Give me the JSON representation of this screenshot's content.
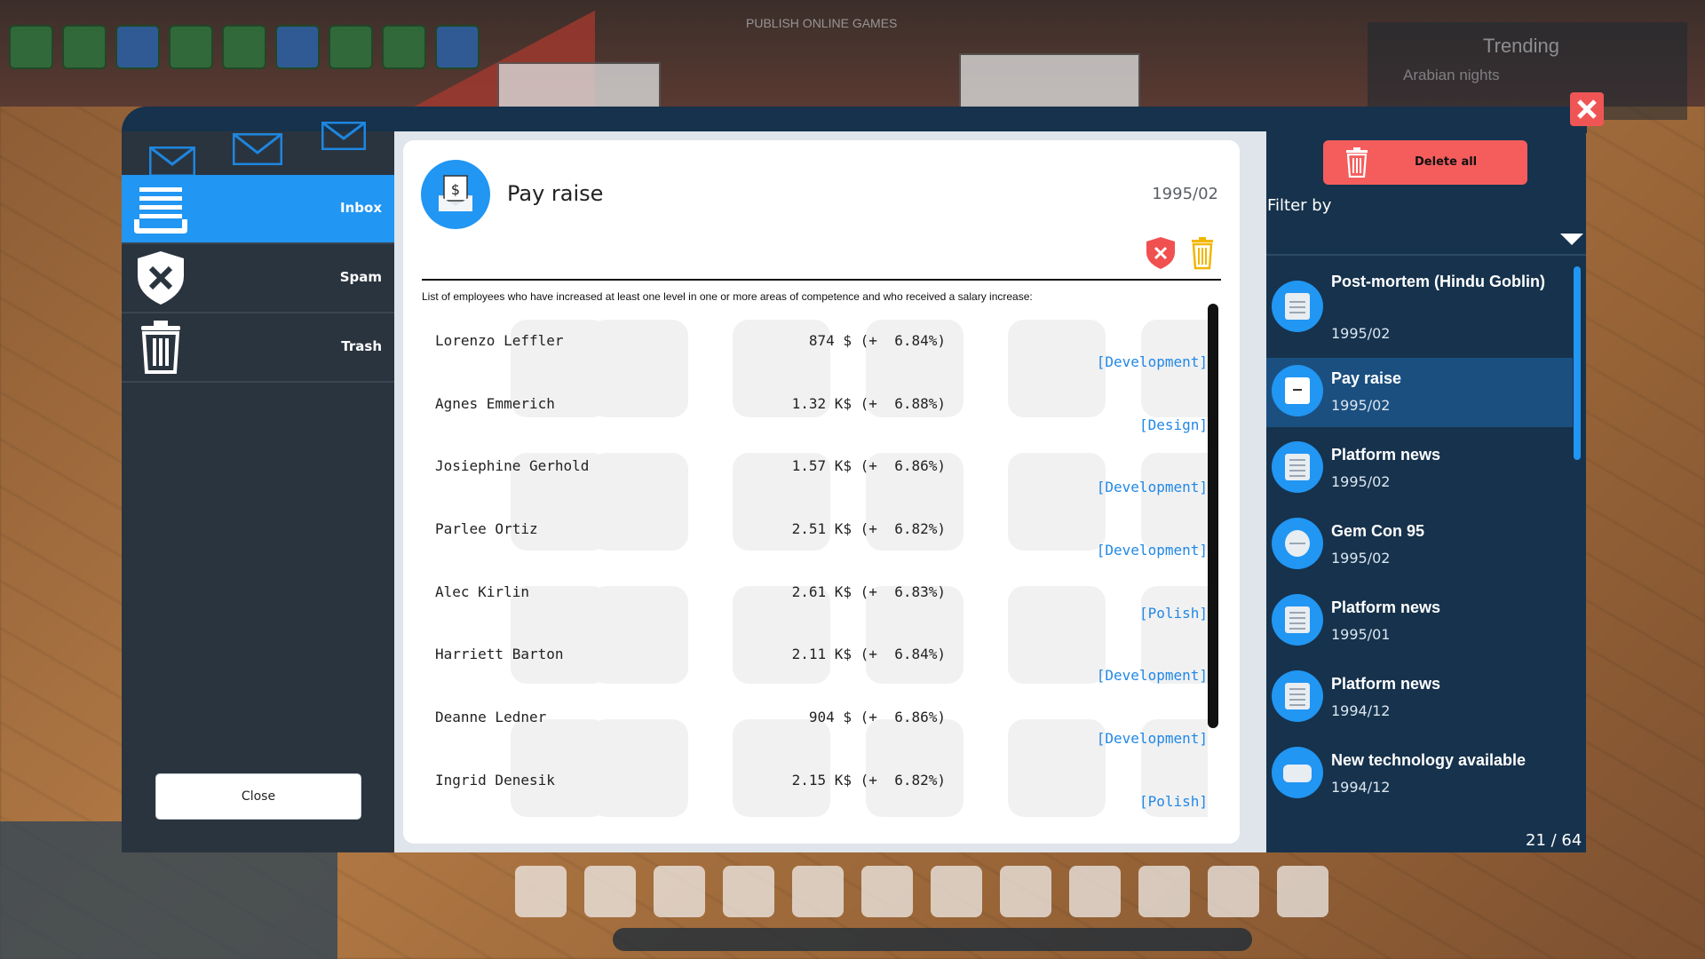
{
  "background": {
    "publish_text": "PUBLISH ONLINE GAMES",
    "trending_title": "Trending",
    "trending_item": "Arabian nights"
  },
  "sidebar": {
    "items": [
      {
        "label": "Inbox",
        "icon": "inbox-icon",
        "active": true
      },
      {
        "label": "Spam",
        "icon": "shield-x-icon",
        "active": false
      },
      {
        "label": "Trash",
        "icon": "trash-icon",
        "active": false
      }
    ],
    "close_label": "Close"
  },
  "message": {
    "title": "Pay raise",
    "date": "1995/02",
    "intro": "List of employees who have increased at least one level in one or more areas of competence and who received a salary increase:",
    "rows": [
      {
        "name": "Lorenzo Leffler",
        "amount": "874 $ (+  6.84%)",
        "area": "[Development]"
      },
      {
        "name": "Agnes Emmerich",
        "amount": "1.32 K$ (+  6.88%)",
        "area": "[Design]"
      },
      {
        "name": "Josiephine Gerhold",
        "amount": "1.57 K$ (+  6.86%)",
        "area": "[Development]"
      },
      {
        "name": "Parlee Ortiz",
        "amount": "2.51 K$ (+  6.82%)",
        "area": "[Development]"
      },
      {
        "name": "Alec Kirlin",
        "amount": "2.61 K$ (+  6.83%)",
        "area": "[Polish]"
      },
      {
        "name": "Harriett Barton",
        "amount": "2.11 K$ (+  6.84%)",
        "area": "[Development]"
      },
      {
        "name": "Deanne Ledner",
        "amount": "904 $ (+  6.86%)",
        "area": "[Development]"
      },
      {
        "name": "Ingrid Denesik",
        "amount": "2.15 K$ (+  6.82%)",
        "area": "[Polish]"
      }
    ]
  },
  "list_panel": {
    "delete_all_label": "Delete all",
    "filter_label": "Filter by",
    "items": [
      {
        "title": "Post-mortem (Hindu Goblin)",
        "date": "1995/02",
        "icon": "clipboard-icon",
        "selected": false
      },
      {
        "title": "Pay raise",
        "date": "1995/02",
        "icon": "pay-envelope-icon",
        "selected": true
      },
      {
        "title": "Platform news",
        "date": "1995/02",
        "icon": "newspaper-icon",
        "selected": false
      },
      {
        "title": "Gem Con 95",
        "date": "1995/02",
        "icon": "convention-icon",
        "selected": false
      },
      {
        "title": "Platform news",
        "date": "1995/01",
        "icon": "newspaper-icon",
        "selected": false
      },
      {
        "title": "Platform news",
        "date": "1994/12",
        "icon": "newspaper-icon",
        "selected": false
      },
      {
        "title": "New technology available",
        "date": "1994/12",
        "icon": "gamepad-gear-icon",
        "selected": false
      }
    ],
    "page_count": "21 / 64"
  },
  "colors": {
    "accent": "#2196f3",
    "panel_dark": "#16324c",
    "danger": "#f55d5d",
    "link": "#2188e6"
  }
}
